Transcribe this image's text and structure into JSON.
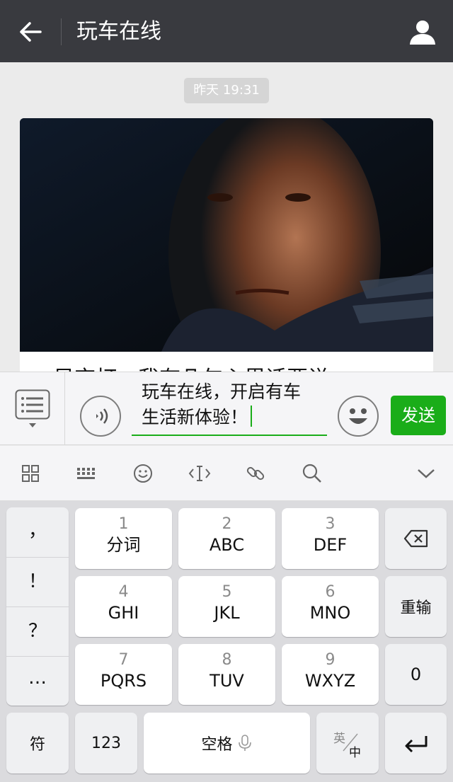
{
  "header": {
    "title": "玩车在线"
  },
  "chat": {
    "timestamp": "昨天 19:31",
    "article": {
      "title_partial": "· 吴京打：我有几句心里话要说"
    }
  },
  "input": {
    "line1": "玩车在线，开启有车",
    "line2": "生活新体验！",
    "send_label": "发送"
  },
  "keyboard": {
    "punctuation": [
      "，",
      "！",
      "？",
      "…"
    ],
    "keys": [
      {
        "num": "1",
        "letters": "分词"
      },
      {
        "num": "2",
        "letters": "ABC"
      },
      {
        "num": "3",
        "letters": "DEF"
      },
      {
        "num": "4",
        "letters": "GHI"
      },
      {
        "num": "5",
        "letters": "JKL"
      },
      {
        "num": "6",
        "letters": "MNO"
      },
      {
        "num": "7",
        "letters": "PQRS"
      },
      {
        "num": "8",
        "letters": "TUV"
      },
      {
        "num": "9",
        "letters": "WXYZ"
      }
    ],
    "reinput_label": "重输",
    "zero_label": "0",
    "symbol_label": "符",
    "numeric_label": "123",
    "space_label": "空格",
    "lang_en": "英",
    "lang_zh": "中"
  },
  "colors": {
    "topbar": "#393a3f",
    "accent_green": "#1aad19",
    "keyboard_bg": "#dbdbde"
  }
}
